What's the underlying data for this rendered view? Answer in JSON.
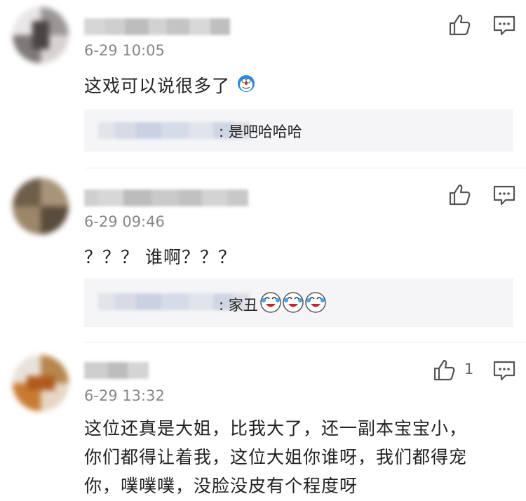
{
  "comments": [
    {
      "time": "6-29 10:05",
      "text": "这戏可以说很多了",
      "reply": {
        "text": ": 是吧哈哈哈"
      },
      "like_count": ""
    },
    {
      "time": "6-29 09:46",
      "text": "？？？ 谁啊？？？",
      "reply": {
        "text": ": 家丑"
      },
      "like_count": ""
    },
    {
      "time": "6-29 13:32",
      "text_lines": [
        "这位还真是大姐，比我大了，还一副本宝宝小，",
        "你们都得让着我，这位大姐你谁呀，我们都得宠",
        "你，噗噗噗，没脸没皮有个程度呀"
      ],
      "like_count": "1"
    }
  ],
  "icons": {
    "like": "thumbs-up-icon",
    "reply": "comment-icon",
    "emoji_1": "doraemon-emoji",
    "emoji_2": "laughing-emoji"
  },
  "colors": {
    "time": "#888888",
    "reply_bg": "#f5f5f7",
    "icon": "#555555"
  }
}
